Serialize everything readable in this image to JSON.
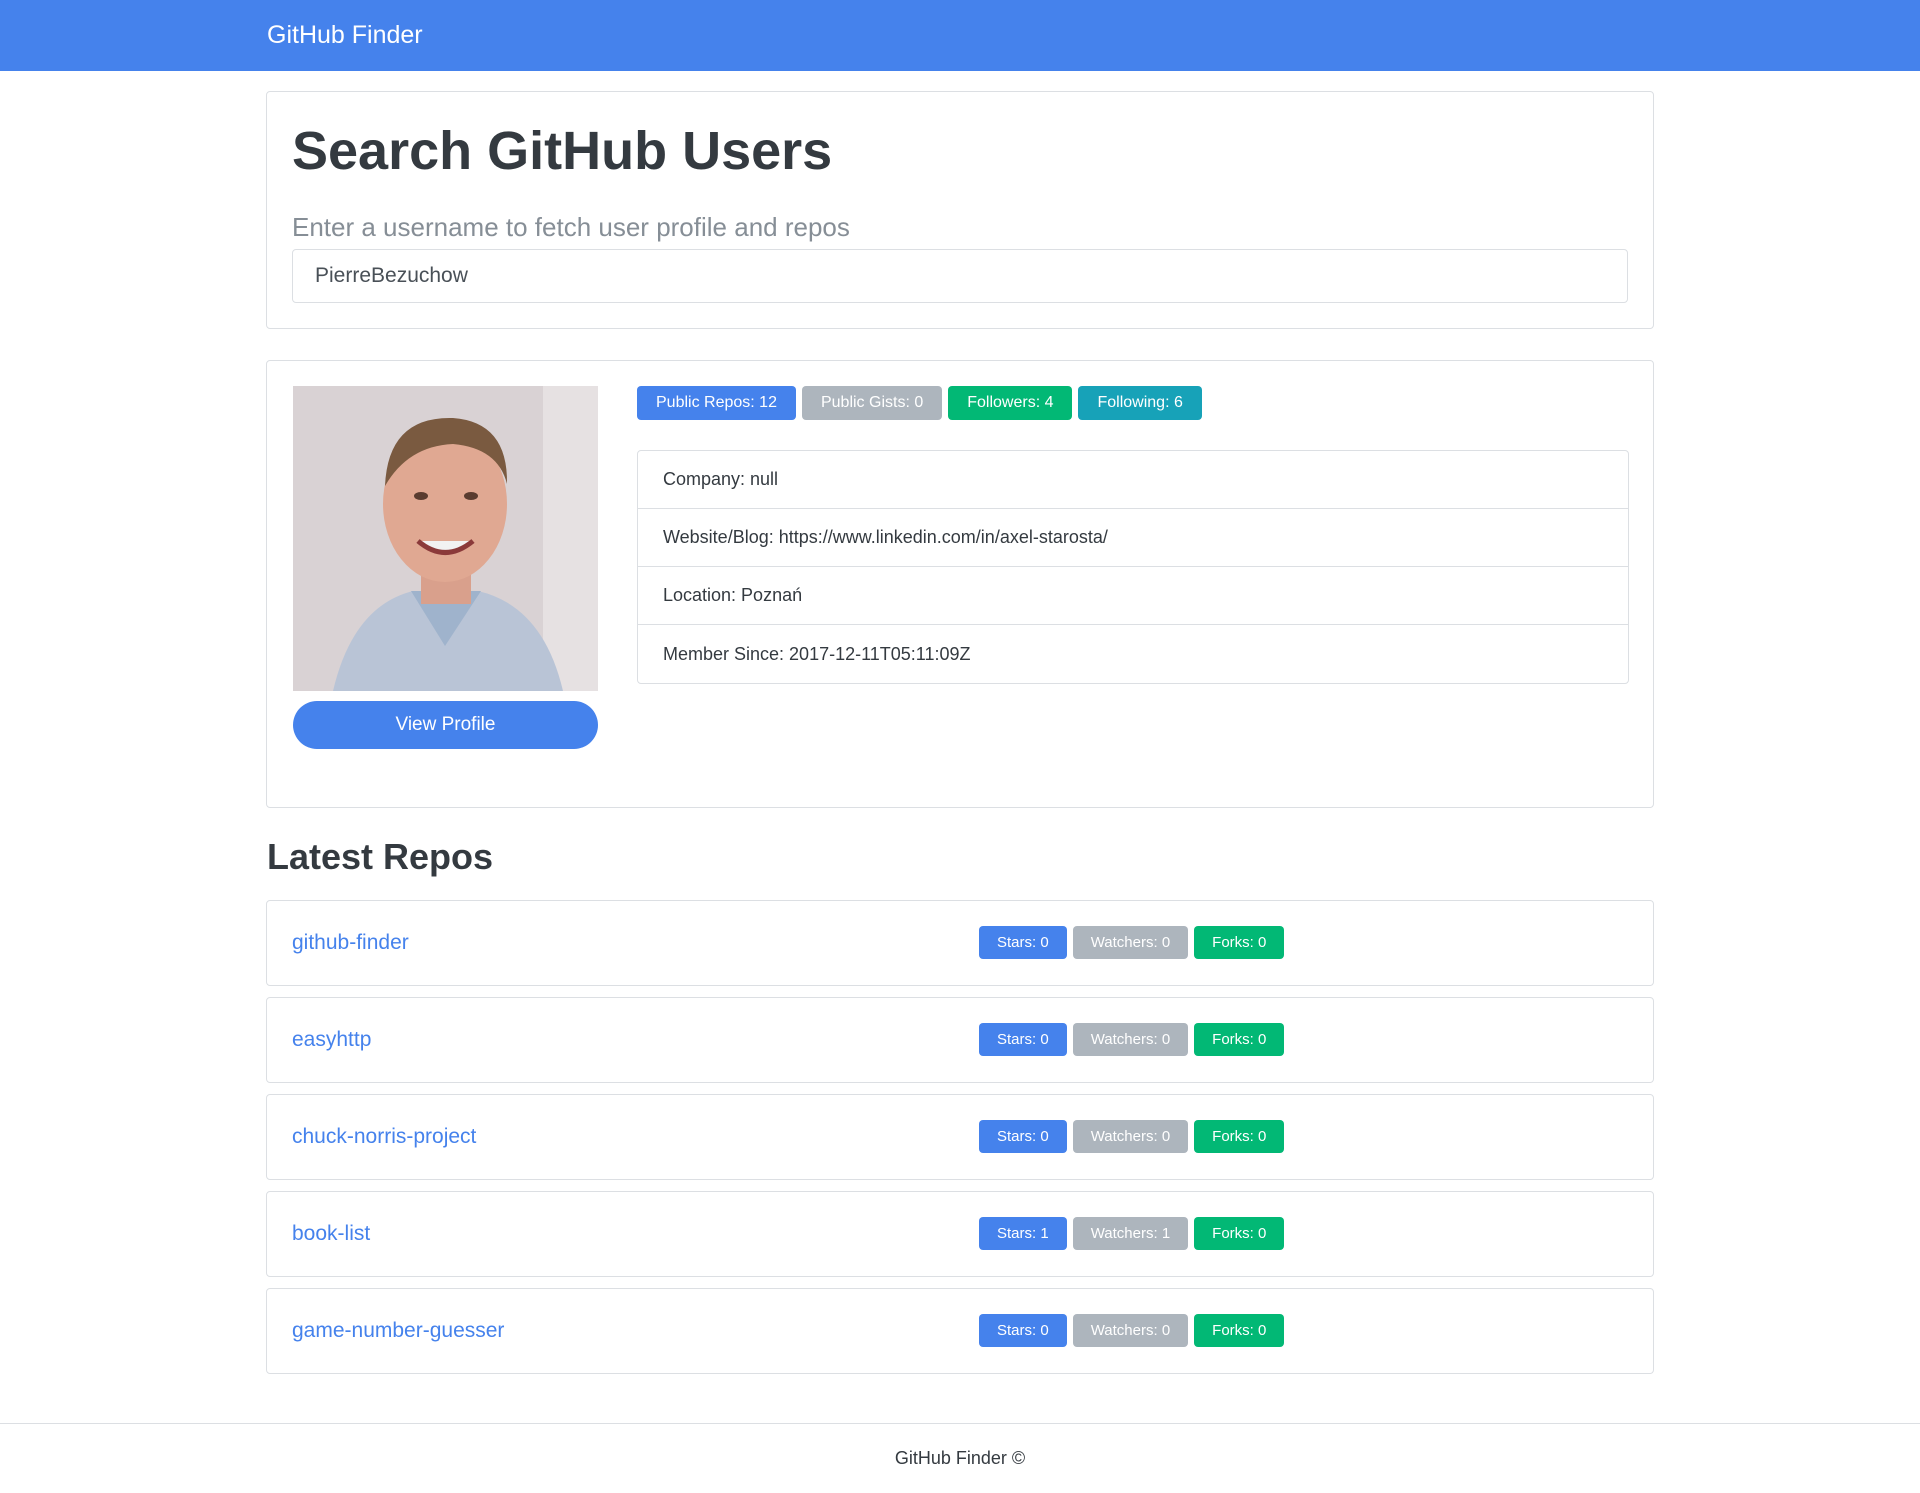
{
  "navbar": {
    "brand": "GitHub Finder"
  },
  "search": {
    "title": "Search GitHub Users",
    "lead": "Enter a username to fetch user profile and repos",
    "value": "PierreBezuchow",
    "placeholder": ""
  },
  "profile": {
    "view_profile_label": "View Profile",
    "badges": [
      {
        "label": "Public Repos: 12",
        "color": "#4582ec"
      },
      {
        "label": "Public Gists: 0",
        "color": "#adb5bd"
      },
      {
        "label": "Followers: 4",
        "color": "#02b875"
      },
      {
        "label": "Following: 6",
        "color": "#17a2b8"
      }
    ],
    "info": [
      "Company: null",
      "Website/Blog: https://www.linkedin.com/in/axel-starosta/",
      "Location: Poznań",
      "Member Since: 2017-12-11T05:11:09Z"
    ]
  },
  "repos": {
    "title": "Latest Repos",
    "items": [
      {
        "name": "github-finder",
        "stars": "Stars: 0",
        "watchers": "Watchers: 0",
        "forks": "Forks: 0"
      },
      {
        "name": "easyhttp",
        "stars": "Stars: 0",
        "watchers": "Watchers: 0",
        "forks": "Forks: 0"
      },
      {
        "name": "chuck-norris-project",
        "stars": "Stars: 0",
        "watchers": "Watchers: 0",
        "forks": "Forks: 0"
      },
      {
        "name": "book-list",
        "stars": "Stars: 1",
        "watchers": "Watchers: 1",
        "forks": "Forks: 0"
      },
      {
        "name": "game-number-guesser",
        "stars": "Stars: 0",
        "watchers": "Watchers: 0",
        "forks": "Forks: 0"
      }
    ]
  },
  "footer": {
    "text": "GitHub Finder ©"
  },
  "colors": {
    "primary": "#4582ec",
    "secondary": "#adb5bd",
    "success": "#02b875",
    "info": "#17a2b8"
  }
}
